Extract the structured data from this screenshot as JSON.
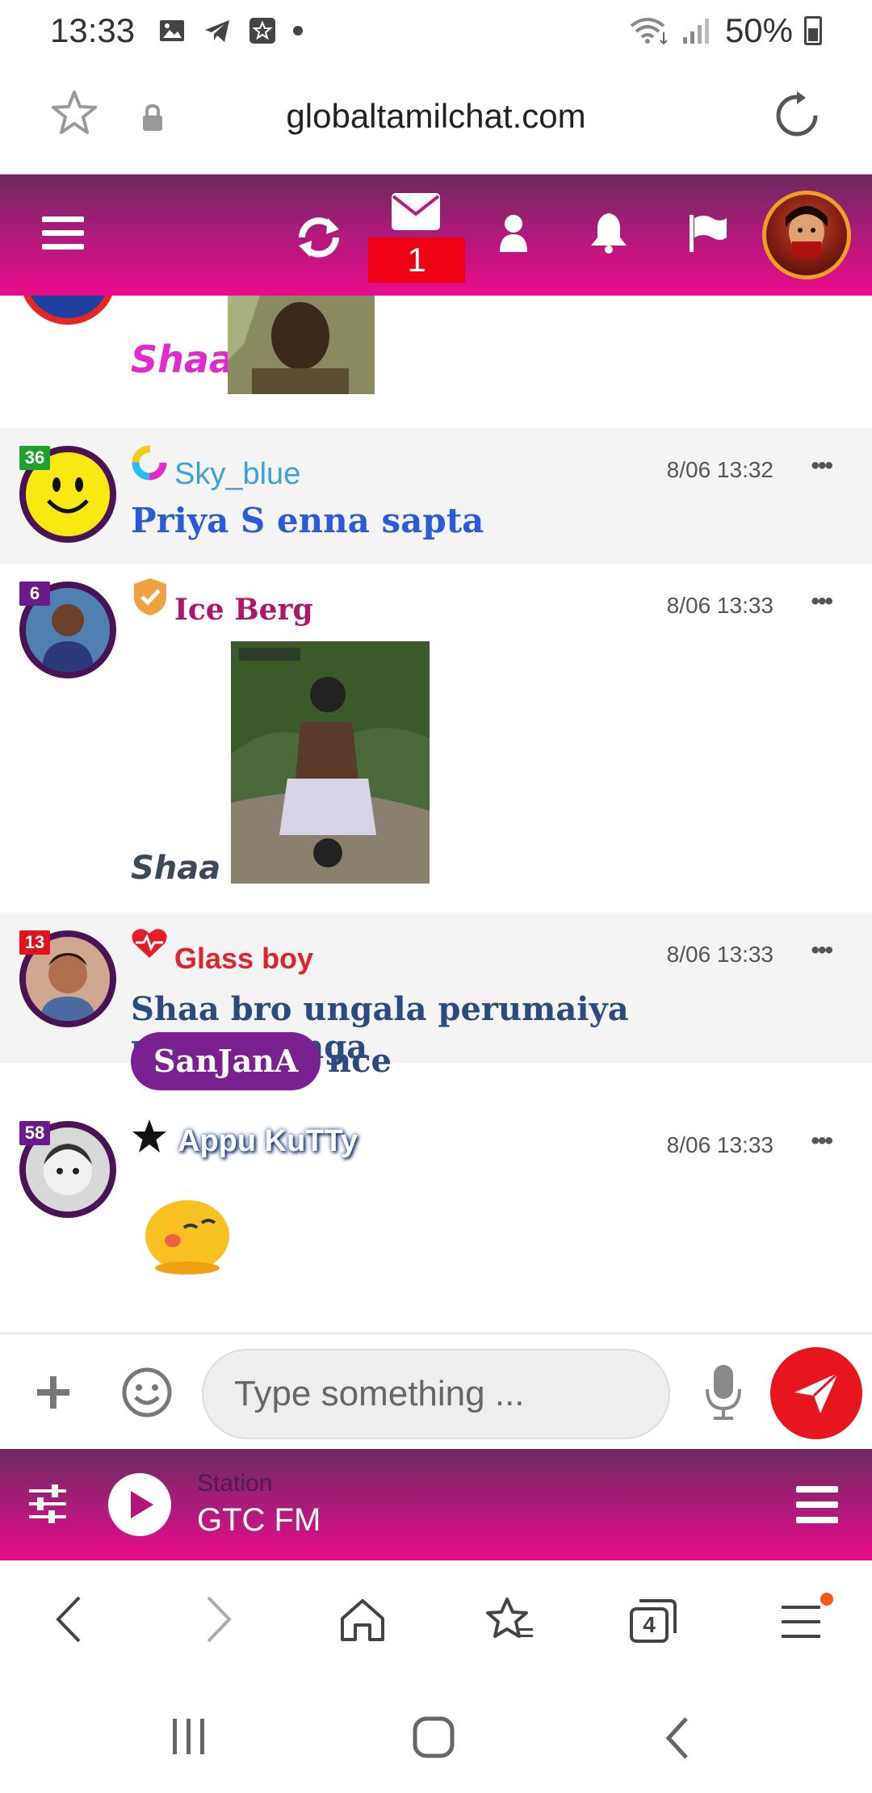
{
  "status_bar": {
    "time": "13:33",
    "battery": "50%"
  },
  "browser": {
    "url": "globaltamilchat.com"
  },
  "header": {
    "mail_badge": "1"
  },
  "messages": [
    {
      "user": "",
      "time": "",
      "text": "Shaa",
      "rank": ""
    },
    {
      "user": "Sky_blue",
      "time": "8/06 13:32",
      "text": "Priya S enna sapta",
      "rank": "36"
    },
    {
      "user": "Ice Berg",
      "time": "8/06 13:33",
      "text": "Shaa",
      "rank": "6"
    },
    {
      "user": "Glass boy",
      "time": "8/06 13:33",
      "text": "Shaa bro ungala perumaiya pesiriukanga",
      "mention": "SanJanA",
      "text2": "nce",
      "rank": "13"
    },
    {
      "user": "Appu KuTTy",
      "time": "8/06 13:33",
      "text": "",
      "rank": "58"
    }
  ],
  "input": {
    "placeholder": "Type something ..."
  },
  "radio": {
    "label": "Station",
    "name": "GTC FM"
  },
  "browser_nav": {
    "tabs_count": "4"
  },
  "colors": {
    "header_gradient_start": "#6b2a5e",
    "header_gradient_end": "#ea0a8a",
    "send_button": "#e8151c",
    "badge_red": "#f00015"
  }
}
